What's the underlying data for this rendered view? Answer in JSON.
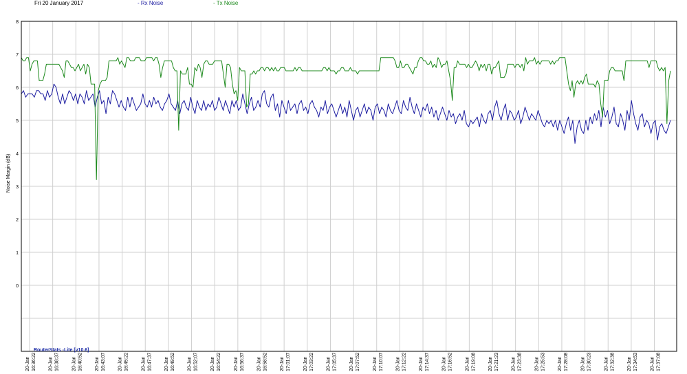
{
  "header": {
    "date": "Fri 20 January 2017"
  },
  "watermark": "RouterStats -Lite [v10.6]",
  "colors": {
    "rx": "#1c1ca0",
    "tx": "#1e8a1e",
    "grid": "#cfcfcf",
    "axis": "#000000"
  },
  "chart_data": {
    "type": "line",
    "ylabel": "Noise Margin (dB)",
    "ylim": [
      -2,
      8
    ],
    "yticks": [
      8,
      7,
      6,
      5,
      4,
      3,
      2,
      1,
      0
    ],
    "grid": true,
    "legend_position": "top",
    "x_tick_labels": [
      {
        "date": "20-Jan",
        "time": "16:36:22"
      },
      {
        "date": "20-Jan",
        "time": "16:38:37"
      },
      {
        "date": "20-Jan",
        "time": "16:40:52"
      },
      {
        "date": "20-Jan",
        "time": "16:43:07"
      },
      {
        "date": "20-Jan",
        "time": "16:45:22"
      },
      {
        "date": "20-Jan",
        "time": "16:47:37"
      },
      {
        "date": "20-Jan",
        "time": "16:49:52"
      },
      {
        "date": "20-Jan",
        "time": "16:52:07"
      },
      {
        "date": "20-Jan",
        "time": "16:54:22"
      },
      {
        "date": "20-Jan",
        "time": "16:56:37"
      },
      {
        "date": "20-Jan",
        "time": "16:58:52"
      },
      {
        "date": "20-Jan",
        "time": "17:01:07"
      },
      {
        "date": "20-Jan",
        "time": "17:03:22"
      },
      {
        "date": "20-Jan",
        "time": "17:05:37"
      },
      {
        "date": "20-Jan",
        "time": "17:07:52"
      },
      {
        "date": "20-Jan",
        "time": "17:10:07"
      },
      {
        "date": "20-Jan",
        "time": "17:12:22"
      },
      {
        "date": "20-Jan",
        "time": "17:14:37"
      },
      {
        "date": "20-Jan",
        "time": "17:16:52"
      },
      {
        "date": "20-Jan",
        "time": "17:19:08"
      },
      {
        "date": "20-Jan",
        "time": "17:21:23"
      },
      {
        "date": "20-Jan",
        "time": "17:23:38"
      },
      {
        "date": "20-Jan",
        "time": "17:25:53"
      },
      {
        "date": "20-Jan",
        "time": "17:28:08"
      },
      {
        "date": "20-Jan",
        "time": "17:30:23"
      },
      {
        "date": "20-Jan",
        "time": "17:32:38"
      },
      {
        "date": "20-Jan",
        "time": "17:34:53"
      },
      {
        "date": "20-Jan",
        "time": "17:37:08"
      }
    ],
    "series": [
      {
        "name": "Rx Noise",
        "color": "#1c1ca0",
        "values": [
          5.8,
          5.9,
          5.7,
          5.8,
          5.8,
          5.8,
          5.7,
          5.9,
          5.9,
          5.8,
          5.8,
          5.6,
          5.9,
          5.7,
          5.8,
          6.1,
          6.0,
          5.7,
          5.5,
          5.8,
          5.5,
          5.7,
          5.9,
          5.8,
          5.6,
          5.8,
          5.5,
          5.8,
          5.7,
          5.5,
          5.9,
          5.6,
          5.7,
          5.8,
          5.4,
          5.7,
          5.9,
          5.5,
          5.6,
          5.2,
          5.7,
          5.5,
          5.9,
          5.8,
          5.6,
          5.4,
          5.6,
          5.4,
          5.3,
          5.7,
          5.4,
          5.7,
          5.5,
          5.3,
          5.4,
          5.5,
          5.8,
          5.5,
          5.4,
          5.6,
          5.4,
          5.7,
          5.5,
          5.6,
          5.4,
          5.3,
          5.5,
          5.6,
          5.8,
          5.5,
          5.4,
          5.3,
          5.6,
          5.2,
          5.5,
          5.6,
          5.4,
          5.3,
          5.7,
          5.4,
          5.2,
          5.6,
          5.4,
          5.3,
          5.6,
          5.3,
          5.5,
          5.4,
          5.6,
          5.3,
          5.4,
          5.7,
          5.5,
          5.3,
          5.6,
          5.4,
          5.2,
          5.6,
          5.4,
          5.6,
          5.3,
          5.4,
          5.8,
          5.5,
          5.2,
          5.5,
          5.7,
          5.3,
          5.4,
          5.6,
          5.4,
          5.8,
          5.9,
          5.5,
          5.4,
          5.7,
          5.8,
          5.3,
          5.5,
          5.1,
          5.6,
          5.4,
          5.2,
          5.6,
          5.3,
          5.4,
          5.5,
          5.2,
          5.5,
          5.6,
          5.3,
          5.4,
          5.2,
          5.5,
          5.6,
          5.4,
          5.3,
          5.1,
          5.4,
          5.3,
          5.6,
          5.2,
          5.4,
          5.5,
          5.3,
          5.1,
          5.3,
          5.5,
          5.2,
          5.4,
          5.1,
          5.6,
          5.3,
          5.0,
          5.3,
          5.4,
          5.1,
          5.3,
          5.5,
          5.2,
          5.4,
          5.3,
          5.0,
          5.4,
          5.5,
          5.2,
          5.4,
          5.3,
          5.1,
          5.5,
          5.3,
          5.2,
          5.4,
          5.6,
          5.3,
          5.2,
          5.6,
          5.4,
          5.3,
          5.7,
          5.4,
          5.2,
          5.5,
          5.3,
          5.1,
          5.4,
          5.3,
          5.5,
          5.2,
          5.4,
          5.1,
          5.3,
          5.0,
          5.2,
          5.4,
          5.2,
          5.0,
          5.3,
          5.1,
          5.2,
          4.9,
          5.1,
          5.2,
          5.0,
          5.3,
          4.9,
          4.8,
          5.0,
          4.9,
          5.0,
          5.1,
          4.8,
          5.2,
          5.0,
          4.9,
          5.2,
          5.3,
          5.0,
          5.4,
          5.6,
          5.2,
          5.0,
          5.3,
          5.5,
          5.0,
          5.3,
          5.2,
          5.0,
          5.1,
          5.3,
          4.9,
          5.1,
          5.4,
          5.2,
          5.0,
          5.2,
          5.1,
          5.0,
          5.3,
          5.1,
          4.9,
          4.8,
          5.0,
          4.9,
          5.0,
          4.8,
          5.0,
          4.7,
          5.0,
          4.8,
          4.6,
          4.9,
          5.1,
          4.7,
          5.0,
          4.3,
          4.8,
          5.0,
          4.7,
          4.6,
          5.0,
          4.7,
          5.1,
          4.9,
          5.2,
          5.0,
          5.3,
          4.8,
          5.4,
          5.1,
          5.3,
          4.9,
          5.1,
          5.4,
          4.9,
          4.8,
          5.2,
          5.0,
          4.7,
          5.3,
          5.0,
          5.6,
          5.2,
          4.9,
          4.7,
          5.1,
          5.2,
          4.8,
          5.0,
          4.9,
          4.6,
          4.9,
          5.0,
          4.4,
          4.8,
          4.9,
          4.7,
          4.6,
          4.8,
          5.0
        ]
      },
      {
        "name": "Tx Noise",
        "color": "#1e8a1e",
        "values": [
          6.9,
          6.8,
          6.8,
          6.9,
          6.9,
          6.5,
          6.7,
          6.8,
          6.8,
          6.8,
          6.2,
          6.2,
          6.2,
          6.4,
          6.7,
          6.7,
          6.7,
          6.7,
          6.7,
          6.7,
          6.7,
          6.7,
          6.6,
          6.5,
          6.3,
          6.8,
          6.8,
          6.7,
          6.6,
          6.6,
          6.5,
          6.6,
          6.7,
          6.5,
          6.6,
          6.7,
          6.4,
          6.7,
          6.6,
          6.1,
          6.1,
          6.1,
          3.2,
          5.9,
          6.1,
          6.2,
          6.2,
          6.2,
          6.3,
          6.8,
          6.8,
          6.8,
          6.8,
          6.8,
          6.9,
          6.7,
          6.8,
          6.7,
          6.6,
          6.9,
          6.9,
          6.8,
          6.8,
          6.8,
          6.9,
          6.9,
          6.9,
          6.8,
          6.8,
          6.8,
          6.9,
          6.9,
          6.9,
          6.9,
          6.8,
          6.9,
          6.9,
          6.7,
          6.3,
          6.6,
          6.8,
          6.8,
          6.8,
          6.8,
          6.8,
          6.6,
          6.5,
          6.5,
          4.7,
          6.5,
          6.4,
          6.4,
          6.4,
          6.6,
          6.1,
          6.1,
          6.0,
          6.6,
          6.5,
          6.7,
          6.6,
          6.3,
          6.7,
          6.8,
          6.8,
          6.7,
          6.7,
          6.7,
          6.8,
          6.8,
          6.8,
          6.8,
          6.8,
          6.4,
          6.0,
          6.7,
          6.7,
          6.6,
          6.1,
          5.8,
          5.9,
          5.6,
          6.6,
          6.5,
          6.5,
          6.5,
          5.4,
          5.5,
          6.4,
          6.4,
          6.5,
          6.4,
          6.5,
          6.5,
          6.6,
          6.6,
          6.5,
          6.6,
          6.6,
          6.5,
          6.6,
          6.5,
          6.6,
          6.5,
          6.5,
          6.6,
          6.6,
          6.6,
          6.5,
          6.5,
          6.5,
          6.5,
          6.5,
          6.6,
          6.5,
          6.6,
          6.6,
          6.5,
          6.5,
          6.5,
          6.5,
          6.5,
          6.5,
          6.5,
          6.5,
          6.5,
          6.5,
          6.5,
          6.5,
          6.6,
          6.6,
          6.5,
          6.6,
          6.5,
          6.5,
          6.5,
          6.4,
          6.5,
          6.5,
          6.6,
          6.6,
          6.5,
          6.5,
          6.5,
          6.6,
          6.5,
          6.5,
          6.5,
          6.4,
          6.5,
          6.5,
          6.5,
          6.5,
          6.5,
          6.5,
          6.5,
          6.5,
          6.5,
          6.5,
          6.5,
          6.5,
          6.9,
          6.9,
          6.9,
          6.9,
          6.9,
          6.9,
          6.9,
          6.9,
          6.8,
          6.6,
          6.6,
          6.8,
          6.6,
          6.6,
          6.7,
          6.7,
          6.6,
          6.5,
          6.4,
          6.6,
          6.6,
          6.8,
          6.9,
          6.9,
          6.8,
          6.8,
          6.7,
          6.7,
          6.8,
          6.6,
          6.7,
          6.6,
          6.9,
          6.8,
          6.6,
          6.7,
          6.7,
          6.8,
          6.5,
          6.2,
          5.6,
          6.6,
          6.6,
          6.8,
          6.7,
          6.7,
          6.7,
          6.7,
          6.6,
          6.7,
          6.6,
          6.6,
          6.7,
          6.8,
          6.7,
          6.5,
          6.7,
          6.6,
          6.7,
          6.5,
          6.7,
          6.7,
          6.4,
          6.6,
          6.6,
          6.7,
          6.8,
          6.3,
          6.3,
          6.3,
          6.4,
          6.7,
          6.7,
          6.7,
          6.7,
          6.6,
          6.7,
          6.7,
          6.6,
          6.7,
          6.5,
          6.9,
          6.7,
          6.8,
          6.8,
          6.8,
          6.9,
          6.7,
          6.8,
          6.7,
          6.8,
          6.8,
          6.8,
          6.8,
          6.8,
          6.7,
          6.8,
          6.7,
          6.8,
          6.8,
          6.9,
          6.9,
          6.9,
          6.9,
          6.5,
          6.1,
          5.9,
          6.2,
          5.7,
          6.1,
          6.2,
          6.1,
          6.2,
          6.1,
          6.3,
          6.4,
          6.1,
          6.1,
          6.1,
          6.1,
          6.0,
          6.2,
          6.1,
          5.5,
          5.1,
          6.2,
          6.2,
          6.2,
          6.5,
          6.6,
          6.6,
          6.5,
          6.5,
          6.5,
          6.5,
          6.5,
          6.2,
          6.8,
          6.8,
          6.8,
          6.8,
          6.8,
          6.8,
          6.8,
          6.8,
          6.8,
          6.8,
          6.8,
          6.8,
          6.8,
          6.6,
          6.8,
          6.8,
          6.8,
          6.8,
          6.6,
          6.5,
          6.6,
          6.5,
          6.6,
          4.9,
          6.2,
          6.5
        ]
      }
    ]
  }
}
